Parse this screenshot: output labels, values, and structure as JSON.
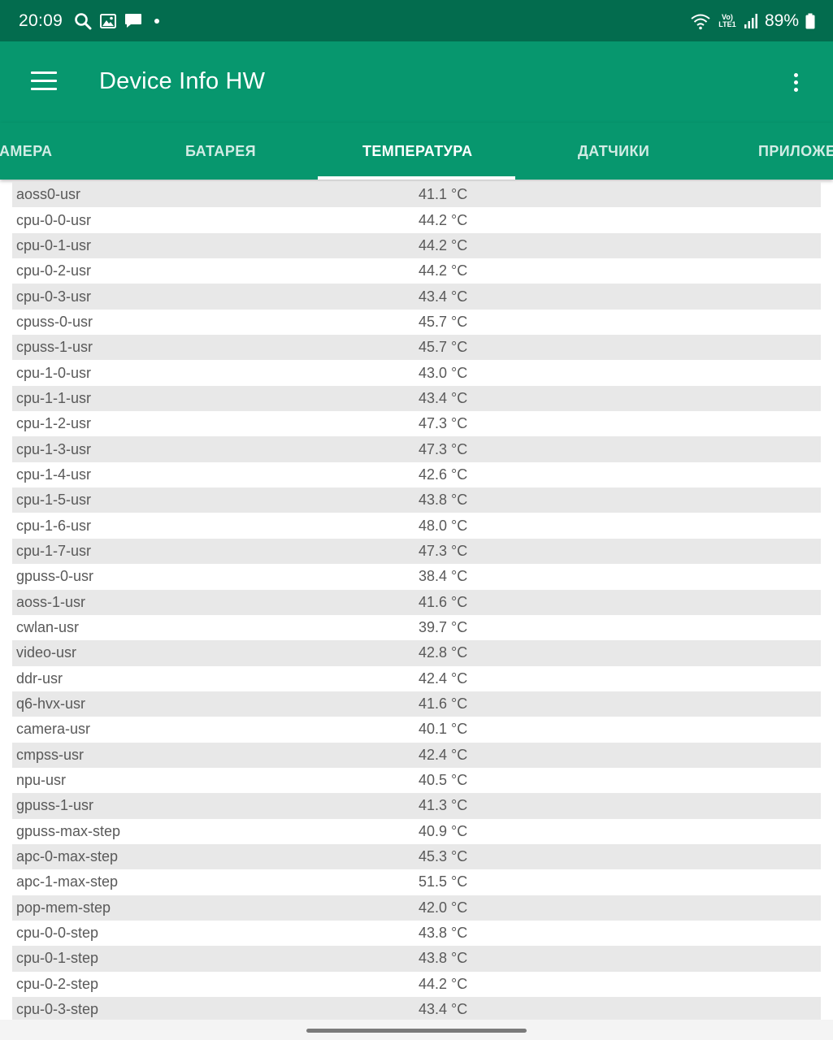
{
  "status_bar": {
    "time": "20:09",
    "network_label": "Vo) LTE1",
    "battery": "89%",
    "icons": [
      "search-icon",
      "gallery-icon",
      "message-icon",
      "dot-icon",
      "wifi-icon",
      "volte-icon",
      "signal-icon",
      "battery-icon"
    ]
  },
  "app_bar": {
    "title": "Device Info HW",
    "menu_icon": "hamburger-menu-icon",
    "overflow_icon": "more-vert-icon"
  },
  "tabs": [
    {
      "label": "АМЕРА"
    },
    {
      "label": "БАТАРЕЯ"
    },
    {
      "label": "ТЕМПЕРАТУРА",
      "active": true
    },
    {
      "label": "ДАТЧИКИ"
    },
    {
      "label": "ПРИЛОЖЕ"
    }
  ],
  "sensors": [
    {
      "name": "aoss0-usr",
      "value": "41.1 °C"
    },
    {
      "name": "cpu-0-0-usr",
      "value": "44.2 °C"
    },
    {
      "name": "cpu-0-1-usr",
      "value": "44.2 °C"
    },
    {
      "name": "cpu-0-2-usr",
      "value": "44.2 °C"
    },
    {
      "name": "cpu-0-3-usr",
      "value": "43.4 °C"
    },
    {
      "name": "cpuss-0-usr",
      "value": "45.7 °C"
    },
    {
      "name": "cpuss-1-usr",
      "value": "45.7 °C"
    },
    {
      "name": "cpu-1-0-usr",
      "value": "43.0 °C"
    },
    {
      "name": "cpu-1-1-usr",
      "value": "43.4 °C"
    },
    {
      "name": "cpu-1-2-usr",
      "value": "47.3 °C"
    },
    {
      "name": "cpu-1-3-usr",
      "value": "47.3 °C"
    },
    {
      "name": "cpu-1-4-usr",
      "value": "42.6 °C"
    },
    {
      "name": "cpu-1-5-usr",
      "value": "43.8 °C"
    },
    {
      "name": "cpu-1-6-usr",
      "value": "48.0 °C"
    },
    {
      "name": "cpu-1-7-usr",
      "value": "47.3 °C"
    },
    {
      "name": "gpuss-0-usr",
      "value": "38.4 °C"
    },
    {
      "name": "aoss-1-usr",
      "value": "41.6 °C"
    },
    {
      "name": "cwlan-usr",
      "value": "39.7 °C"
    },
    {
      "name": "video-usr",
      "value": "42.8 °C"
    },
    {
      "name": "ddr-usr",
      "value": "42.4 °C"
    },
    {
      "name": "q6-hvx-usr",
      "value": "41.6 °C"
    },
    {
      "name": "camera-usr",
      "value": "40.1 °C"
    },
    {
      "name": "cmpss-usr",
      "value": "42.4 °C"
    },
    {
      "name": "npu-usr",
      "value": "40.5 °C"
    },
    {
      "name": "gpuss-1-usr",
      "value": "41.3 °C"
    },
    {
      "name": "gpuss-max-step",
      "value": "40.9 °C"
    },
    {
      "name": "apc-0-max-step",
      "value": "45.3 °C"
    },
    {
      "name": "apc-1-max-step",
      "value": "51.5 °C"
    },
    {
      "name": "pop-mem-step",
      "value": "42.0 °C"
    },
    {
      "name": "cpu-0-0-step",
      "value": "43.8 °C"
    },
    {
      "name": "cpu-0-1-step",
      "value": "43.8 °C"
    },
    {
      "name": "cpu-0-2-step",
      "value": "44.2 °C"
    },
    {
      "name": "cpu-0-3-step",
      "value": "43.4 °C"
    }
  ],
  "colors": {
    "status_bar": "#036c4e",
    "primary": "#07976e",
    "row_alt": "#e8e8e8",
    "text": "#595959"
  }
}
